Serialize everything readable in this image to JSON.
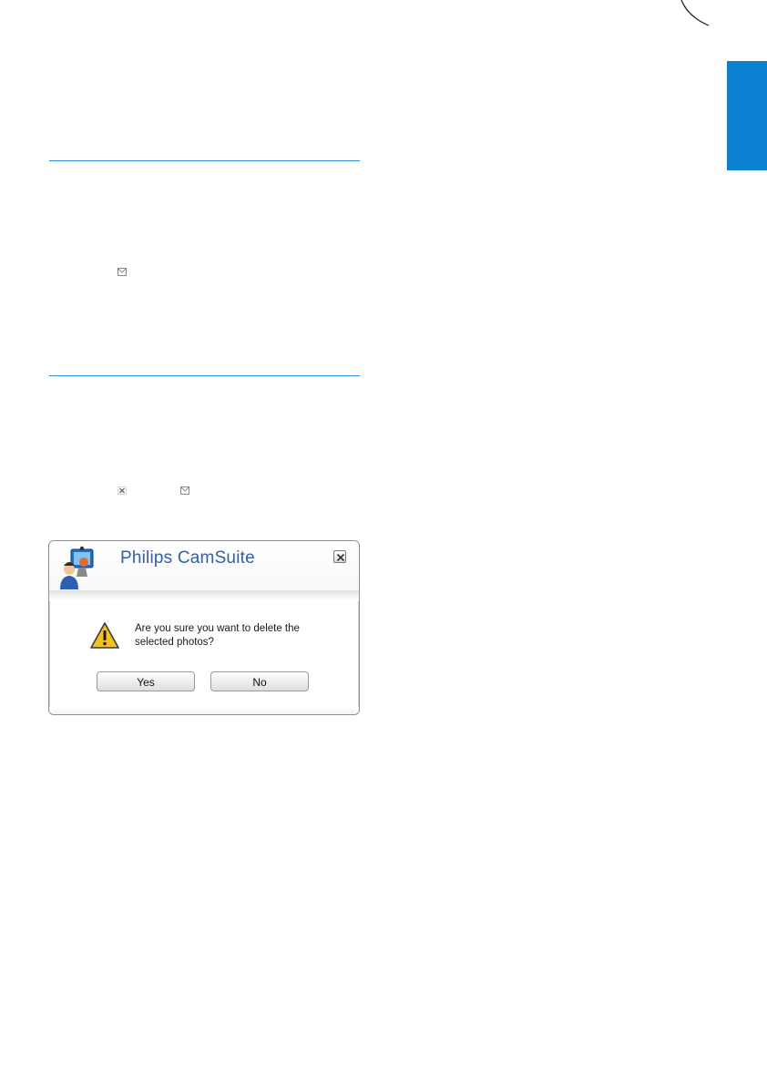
{
  "colors": {
    "accent": "#0b7fd1",
    "rule": "#2a8de0",
    "dialog_title": "#2f5fb0"
  },
  "icons": {
    "inline_1": "envelope-icon",
    "inline_2": "delete-icon",
    "inline_3": "envelope-icon"
  },
  "dialog": {
    "title": "Philips CamSuite",
    "message_line1": "Are you sure you want to delete the",
    "message_line2": "selected photos?",
    "yes_label": "Yes",
    "no_label": "No"
  }
}
